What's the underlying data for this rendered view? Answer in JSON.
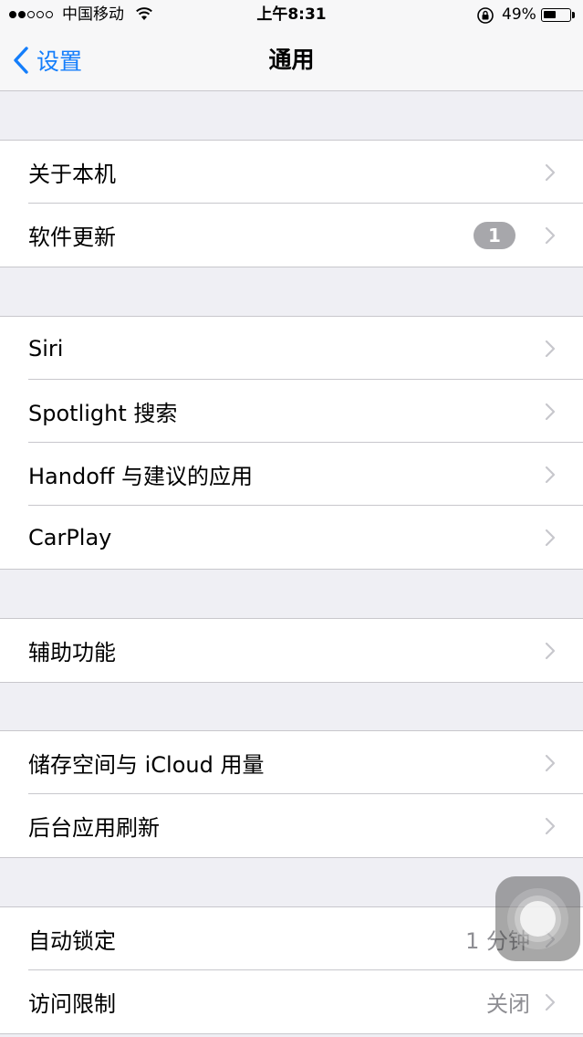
{
  "status_bar": {
    "signal_filled": 2,
    "signal_total": 5,
    "carrier": "中国移动",
    "time": "上午8:31",
    "battery_percent": "49%",
    "battery_level": 0.49
  },
  "nav": {
    "back_label": "设置",
    "title": "通用"
  },
  "groups": [
    {
      "rows": [
        {
          "label": "关于本机"
        },
        {
          "label": "软件更新",
          "badge": "1"
        }
      ]
    },
    {
      "rows": [
        {
          "label": "Siri"
        },
        {
          "label": "Spotlight 搜索"
        },
        {
          "label": "Handoff 与建议的应用"
        },
        {
          "label": "CarPlay"
        }
      ]
    },
    {
      "rows": [
        {
          "label": "辅助功能"
        }
      ]
    },
    {
      "rows": [
        {
          "label": "储存空间与 iCloud 用量"
        },
        {
          "label": "后台应用刷新"
        }
      ]
    },
    {
      "rows": [
        {
          "label": "自动锁定",
          "value": "1 分钟"
        },
        {
          "label": "访问限制",
          "value": "关闭"
        }
      ]
    }
  ],
  "colors": {
    "tint": "#147efb",
    "background": "#efeff4",
    "badge": "#a7a7ab",
    "chevron": "#c7c7cc"
  },
  "icons": {
    "back": "chevron-left-icon",
    "disclosure": "chevron-right-icon",
    "wifi": "wifi-icon",
    "orientation_lock": "orientation-lock-icon",
    "battery": "battery-icon",
    "assistive_touch": "assistive-touch-icon"
  }
}
